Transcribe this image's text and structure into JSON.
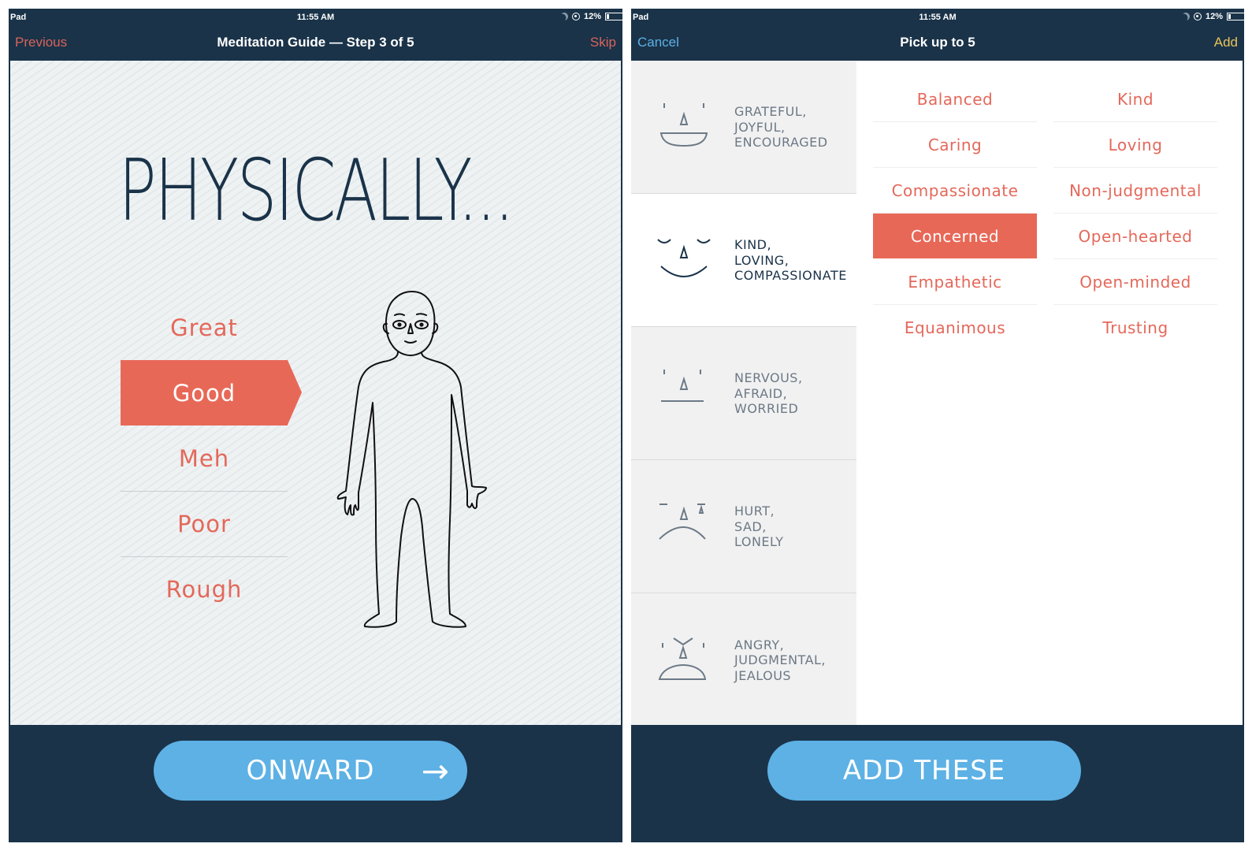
{
  "colors": {
    "navy": "#1a3349",
    "accent_red": "#e86857",
    "button_blue": "#5db1e5",
    "cancel_blue": "#5db1e5",
    "add_yellow": "#e8c35a"
  },
  "left": {
    "status": {
      "carrier": "Pad",
      "time": "11:55 AM",
      "battery": "12%"
    },
    "nav": {
      "left": "Previous",
      "title": "Meditation Guide — Step 3 of 5",
      "right": "Skip"
    },
    "headline": "PHYSICALLY...",
    "ratings": [
      {
        "label": "Great",
        "selected": false
      },
      {
        "label": "Good",
        "selected": true
      },
      {
        "label": "Meh",
        "selected": false
      },
      {
        "label": "Poor",
        "selected": false
      },
      {
        "label": "Rough",
        "selected": false
      }
    ],
    "figure_icon": "human-body-outline-icon",
    "button": {
      "label": "ONWARD",
      "icon": "arrow-right-icon",
      "glyph": "→"
    }
  },
  "right": {
    "status": {
      "carrier": "Pad",
      "time": "11:55 AM",
      "battery": "12%"
    },
    "nav": {
      "left": "Cancel",
      "title": "Pick up to 5",
      "right": "Add"
    },
    "categories": [
      {
        "lines": [
          "GRATEFUL,",
          "JOYFUL,",
          "ENCOURAGED"
        ],
        "icon": "happy-face-icon",
        "selected": false
      },
      {
        "lines": [
          "KIND,",
          "LOVING,",
          "COMPASSIONATE"
        ],
        "icon": "content-face-icon",
        "selected": true
      },
      {
        "lines": [
          "NERVOUS,",
          "AFRAID,",
          "WORRIED"
        ],
        "icon": "neutral-face-icon",
        "selected": false
      },
      {
        "lines": [
          "HURT,",
          "SAD,",
          "LONELY"
        ],
        "icon": "sad-face-icon",
        "selected": false
      },
      {
        "lines": [
          "ANGRY,",
          "JUDGMENTAL,",
          "JEALOUS"
        ],
        "icon": "angry-face-icon",
        "selected": false
      }
    ],
    "words_col1": [
      {
        "label": "Balanced",
        "selected": false
      },
      {
        "label": "Caring",
        "selected": false
      },
      {
        "label": "Compassionate",
        "selected": false
      },
      {
        "label": "Concerned",
        "selected": true
      },
      {
        "label": "Empathetic",
        "selected": false
      },
      {
        "label": "Equanimous",
        "selected": false
      }
    ],
    "words_col2": [
      {
        "label": "Kind",
        "selected": false
      },
      {
        "label": "Loving",
        "selected": false
      },
      {
        "label": "Non-judgmental",
        "selected": false
      },
      {
        "label": "Open-hearted",
        "selected": false
      },
      {
        "label": "Open-minded",
        "selected": false
      },
      {
        "label": "Trusting",
        "selected": false
      }
    ],
    "button": {
      "label": "ADD THESE"
    }
  }
}
